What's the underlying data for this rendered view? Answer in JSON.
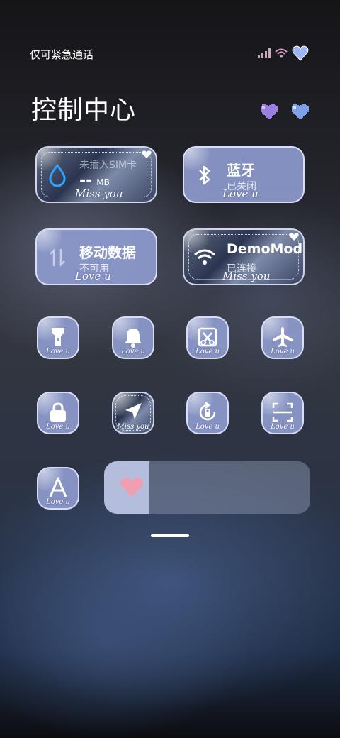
{
  "status_bar": {
    "carrier": "仅可紧急通话",
    "icons": [
      "signal-icon",
      "wifi-icon",
      "heart-icon"
    ]
  },
  "header": {
    "title": "控制中心"
  },
  "colors": {
    "tile": "#8d9acd",
    "accent_purple": "#9a7ee0",
    "accent_blue": "#7ea0e6",
    "slider_heart": "#ee9fb1"
  },
  "big_tiles": [
    {
      "id": "data-usage",
      "label": "未插入SIM卡",
      "value": "--",
      "unit": "MB",
      "sig": "Miss you",
      "icon": "water-drop-icon",
      "active": true
    },
    {
      "id": "bluetooth",
      "label": "蓝牙",
      "sub": "已关闭",
      "sig": "Love u",
      "icon": "bluetooth-icon",
      "active": false
    },
    {
      "id": "mobile-data",
      "label": "移动数据",
      "sub": "不可用",
      "sig": "Love u",
      "icon": "mobile-data-icon",
      "active": false
    },
    {
      "id": "wifi",
      "label": "DemoMod",
      "sub": "已连接",
      "sig": "Miss you",
      "icon": "wifi-icon",
      "active": true
    }
  ],
  "small_tiles": [
    {
      "id": "flashlight",
      "sig": "Love u",
      "icon": "flashlight-icon"
    },
    {
      "id": "bell",
      "sig": "Love u",
      "icon": "bell-icon"
    },
    {
      "id": "screenshot",
      "sig": "Love u",
      "icon": "screenshot-icon"
    },
    {
      "id": "airplane",
      "sig": "Love u",
      "icon": "airplane-icon"
    },
    {
      "id": "lock",
      "sig": "Love u",
      "icon": "lock-icon"
    },
    {
      "id": "location",
      "sig": "Miss you",
      "icon": "location-icon"
    },
    {
      "id": "rotation",
      "sig": "Love u",
      "icon": "rotation-lock-icon"
    },
    {
      "id": "scanner",
      "sig": "Love u",
      "icon": "scan-icon"
    },
    {
      "id": "font",
      "sig": "Love u",
      "icon": "font-icon"
    }
  ],
  "brightness": {
    "level": 0.22
  }
}
